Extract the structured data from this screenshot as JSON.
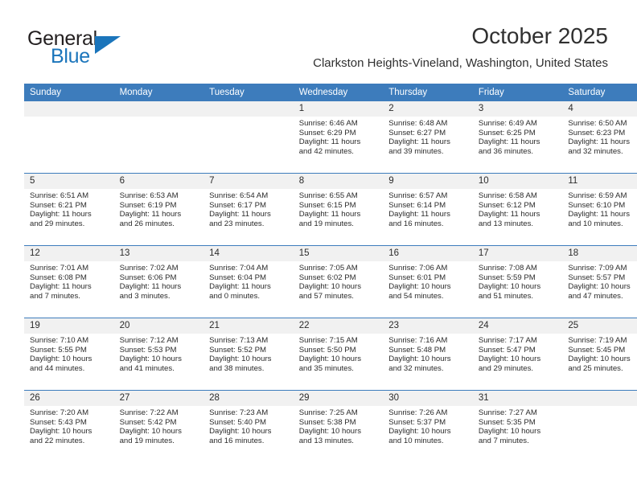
{
  "logo": {
    "word_one": "General",
    "word_two": "Blue",
    "triangle_icon": "triangle-icon",
    "accent_color": "#1b75bb"
  },
  "header": {
    "month_title": "October 2025",
    "location": "Clarkston Heights-Vineland, Washington, United States"
  },
  "calendar": {
    "header_bg": "#3d7cbc",
    "daynum_bg": "#f1f1f1",
    "weekday_headers": [
      "Sunday",
      "Monday",
      "Tuesday",
      "Wednesday",
      "Thursday",
      "Friday",
      "Saturday"
    ],
    "weeks": [
      [
        {
          "day": "",
          "blank": true
        },
        {
          "day": "",
          "blank": true
        },
        {
          "day": "",
          "blank": true
        },
        {
          "day": "1",
          "sunrise": "Sunrise: 6:46 AM",
          "sunset": "Sunset: 6:29 PM",
          "daylight_line1": "Daylight: 11 hours",
          "daylight_line2": "and 42 minutes."
        },
        {
          "day": "2",
          "sunrise": "Sunrise: 6:48 AM",
          "sunset": "Sunset: 6:27 PM",
          "daylight_line1": "Daylight: 11 hours",
          "daylight_line2": "and 39 minutes."
        },
        {
          "day": "3",
          "sunrise": "Sunrise: 6:49 AM",
          "sunset": "Sunset: 6:25 PM",
          "daylight_line1": "Daylight: 11 hours",
          "daylight_line2": "and 36 minutes."
        },
        {
          "day": "4",
          "sunrise": "Sunrise: 6:50 AM",
          "sunset": "Sunset: 6:23 PM",
          "daylight_line1": "Daylight: 11 hours",
          "daylight_line2": "and 32 minutes."
        }
      ],
      [
        {
          "day": "5",
          "sunrise": "Sunrise: 6:51 AM",
          "sunset": "Sunset: 6:21 PM",
          "daylight_line1": "Daylight: 11 hours",
          "daylight_line2": "and 29 minutes."
        },
        {
          "day": "6",
          "sunrise": "Sunrise: 6:53 AM",
          "sunset": "Sunset: 6:19 PM",
          "daylight_line1": "Daylight: 11 hours",
          "daylight_line2": "and 26 minutes."
        },
        {
          "day": "7",
          "sunrise": "Sunrise: 6:54 AM",
          "sunset": "Sunset: 6:17 PM",
          "daylight_line1": "Daylight: 11 hours",
          "daylight_line2": "and 23 minutes."
        },
        {
          "day": "8",
          "sunrise": "Sunrise: 6:55 AM",
          "sunset": "Sunset: 6:15 PM",
          "daylight_line1": "Daylight: 11 hours",
          "daylight_line2": "and 19 minutes."
        },
        {
          "day": "9",
          "sunrise": "Sunrise: 6:57 AM",
          "sunset": "Sunset: 6:14 PM",
          "daylight_line1": "Daylight: 11 hours",
          "daylight_line2": "and 16 minutes."
        },
        {
          "day": "10",
          "sunrise": "Sunrise: 6:58 AM",
          "sunset": "Sunset: 6:12 PM",
          "daylight_line1": "Daylight: 11 hours",
          "daylight_line2": "and 13 minutes."
        },
        {
          "day": "11",
          "sunrise": "Sunrise: 6:59 AM",
          "sunset": "Sunset: 6:10 PM",
          "daylight_line1": "Daylight: 11 hours",
          "daylight_line2": "and 10 minutes."
        }
      ],
      [
        {
          "day": "12",
          "sunrise": "Sunrise: 7:01 AM",
          "sunset": "Sunset: 6:08 PM",
          "daylight_line1": "Daylight: 11 hours",
          "daylight_line2": "and 7 minutes."
        },
        {
          "day": "13",
          "sunrise": "Sunrise: 7:02 AM",
          "sunset": "Sunset: 6:06 PM",
          "daylight_line1": "Daylight: 11 hours",
          "daylight_line2": "and 3 minutes."
        },
        {
          "day": "14",
          "sunrise": "Sunrise: 7:04 AM",
          "sunset": "Sunset: 6:04 PM",
          "daylight_line1": "Daylight: 11 hours",
          "daylight_line2": "and 0 minutes."
        },
        {
          "day": "15",
          "sunrise": "Sunrise: 7:05 AM",
          "sunset": "Sunset: 6:02 PM",
          "daylight_line1": "Daylight: 10 hours",
          "daylight_line2": "and 57 minutes."
        },
        {
          "day": "16",
          "sunrise": "Sunrise: 7:06 AM",
          "sunset": "Sunset: 6:01 PM",
          "daylight_line1": "Daylight: 10 hours",
          "daylight_line2": "and 54 minutes."
        },
        {
          "day": "17",
          "sunrise": "Sunrise: 7:08 AM",
          "sunset": "Sunset: 5:59 PM",
          "daylight_line1": "Daylight: 10 hours",
          "daylight_line2": "and 51 minutes."
        },
        {
          "day": "18",
          "sunrise": "Sunrise: 7:09 AM",
          "sunset": "Sunset: 5:57 PM",
          "daylight_line1": "Daylight: 10 hours",
          "daylight_line2": "and 47 minutes."
        }
      ],
      [
        {
          "day": "19",
          "sunrise": "Sunrise: 7:10 AM",
          "sunset": "Sunset: 5:55 PM",
          "daylight_line1": "Daylight: 10 hours",
          "daylight_line2": "and 44 minutes."
        },
        {
          "day": "20",
          "sunrise": "Sunrise: 7:12 AM",
          "sunset": "Sunset: 5:53 PM",
          "daylight_line1": "Daylight: 10 hours",
          "daylight_line2": "and 41 minutes."
        },
        {
          "day": "21",
          "sunrise": "Sunrise: 7:13 AM",
          "sunset": "Sunset: 5:52 PM",
          "daylight_line1": "Daylight: 10 hours",
          "daylight_line2": "and 38 minutes."
        },
        {
          "day": "22",
          "sunrise": "Sunrise: 7:15 AM",
          "sunset": "Sunset: 5:50 PM",
          "daylight_line1": "Daylight: 10 hours",
          "daylight_line2": "and 35 minutes."
        },
        {
          "day": "23",
          "sunrise": "Sunrise: 7:16 AM",
          "sunset": "Sunset: 5:48 PM",
          "daylight_line1": "Daylight: 10 hours",
          "daylight_line2": "and 32 minutes."
        },
        {
          "day": "24",
          "sunrise": "Sunrise: 7:17 AM",
          "sunset": "Sunset: 5:47 PM",
          "daylight_line1": "Daylight: 10 hours",
          "daylight_line2": "and 29 minutes."
        },
        {
          "day": "25",
          "sunrise": "Sunrise: 7:19 AM",
          "sunset": "Sunset: 5:45 PM",
          "daylight_line1": "Daylight: 10 hours",
          "daylight_line2": "and 25 minutes."
        }
      ],
      [
        {
          "day": "26",
          "sunrise": "Sunrise: 7:20 AM",
          "sunset": "Sunset: 5:43 PM",
          "daylight_line1": "Daylight: 10 hours",
          "daylight_line2": "and 22 minutes."
        },
        {
          "day": "27",
          "sunrise": "Sunrise: 7:22 AM",
          "sunset": "Sunset: 5:42 PM",
          "daylight_line1": "Daylight: 10 hours",
          "daylight_line2": "and 19 minutes."
        },
        {
          "day": "28",
          "sunrise": "Sunrise: 7:23 AM",
          "sunset": "Sunset: 5:40 PM",
          "daylight_line1": "Daylight: 10 hours",
          "daylight_line2": "and 16 minutes."
        },
        {
          "day": "29",
          "sunrise": "Sunrise: 7:25 AM",
          "sunset": "Sunset: 5:38 PM",
          "daylight_line1": "Daylight: 10 hours",
          "daylight_line2": "and 13 minutes."
        },
        {
          "day": "30",
          "sunrise": "Sunrise: 7:26 AM",
          "sunset": "Sunset: 5:37 PM",
          "daylight_line1": "Daylight: 10 hours",
          "daylight_line2": "and 10 minutes."
        },
        {
          "day": "31",
          "sunrise": "Sunrise: 7:27 AM",
          "sunset": "Sunset: 5:35 PM",
          "daylight_line1": "Daylight: 10 hours",
          "daylight_line2": "and 7 minutes."
        },
        {
          "day": "",
          "blank": true
        }
      ]
    ]
  }
}
